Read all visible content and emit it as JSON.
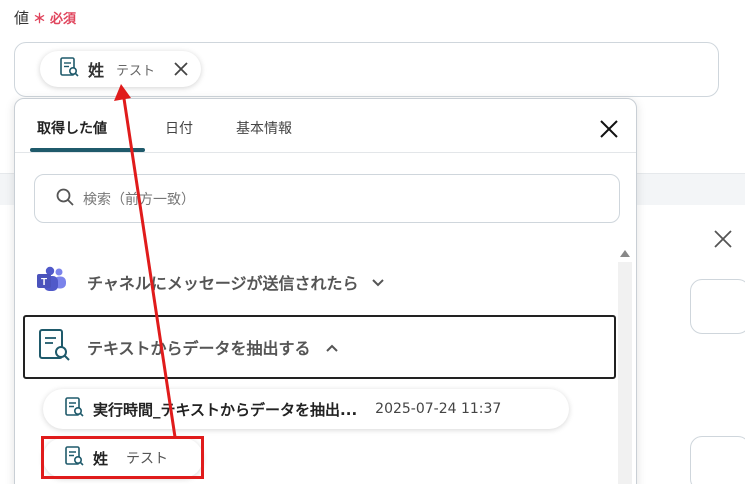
{
  "field": {
    "label": "値",
    "required_mark": "＊",
    "required_text": "必須"
  },
  "chip": {
    "icon": "extract-data-icon",
    "name": "姓",
    "sub": "テスト",
    "close_icon": "close-icon"
  },
  "popup": {
    "tabs": [
      {
        "label": "取得した値",
        "active": true
      },
      {
        "label": "日付",
        "active": false
      },
      {
        "label": "基本情報",
        "active": false
      }
    ],
    "search_placeholder": "検索（前方一致）",
    "groups": [
      {
        "icon": "teams-icon",
        "label": "チャネルにメッセージが送信されたら",
        "expanded": false
      },
      {
        "icon": "extract-data-icon",
        "label": "テキストからデータを抽出する",
        "expanded": true
      }
    ],
    "items": [
      {
        "icon": "extract-data-icon",
        "name": "実行時間_テキストからデータを抽出...",
        "value": "2025-07-24 11:37"
      },
      {
        "icon": "extract-data-icon",
        "name": "姓",
        "value": "テスト"
      }
    ]
  },
  "colors": {
    "accent": "#1f5a6b",
    "required": "#e0455d",
    "annotation": "#e01b1b"
  }
}
